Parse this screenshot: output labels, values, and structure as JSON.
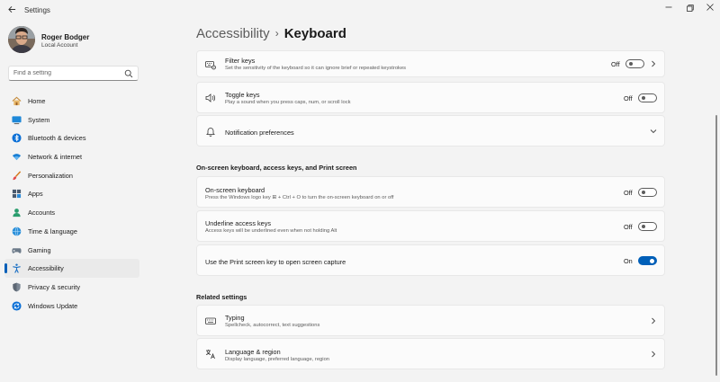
{
  "window": {
    "app_title": "Settings",
    "back_icon": "back-arrow-icon",
    "controls": [
      "minimize-icon",
      "restore-icon",
      "close-icon"
    ]
  },
  "profile": {
    "name": "Roger Bodger",
    "account_type": "Local Account"
  },
  "search": {
    "placeholder": "Find a setting"
  },
  "sidebar": {
    "items": [
      {
        "label": "Home",
        "icon": "home-icon"
      },
      {
        "label": "System",
        "icon": "system-icon"
      },
      {
        "label": "Bluetooth & devices",
        "icon": "bluetooth-icon"
      },
      {
        "label": "Network & internet",
        "icon": "network-icon"
      },
      {
        "label": "Personalization",
        "icon": "brush-icon"
      },
      {
        "label": "Apps",
        "icon": "apps-icon"
      },
      {
        "label": "Accounts",
        "icon": "accounts-icon"
      },
      {
        "label": "Time & language",
        "icon": "globe-clock-icon"
      },
      {
        "label": "Gaming",
        "icon": "gamepad-icon"
      },
      {
        "label": "Accessibility",
        "icon": "accessibility-icon",
        "active": true
      },
      {
        "label": "Privacy & security",
        "icon": "shield-icon"
      },
      {
        "label": "Windows Update",
        "icon": "update-icon"
      }
    ]
  },
  "breadcrumb": {
    "parent": "Accessibility",
    "separator": "›",
    "current": "Keyboard"
  },
  "cards": {
    "filter_keys": {
      "title": "Filter keys",
      "desc": "Set the sensitivity of the keyboard so it can ignore brief or repeated keystrokes",
      "state": "Off"
    },
    "toggle_keys": {
      "title": "Toggle keys",
      "desc": "Play a sound when you press caps, num, or scroll lock",
      "state": "Off"
    },
    "notification_prefs": {
      "title": "Notification preferences"
    },
    "osk": {
      "title": "On-screen keyboard",
      "desc": "Press the Windows logo key ⊞ + Ctrl + O to turn the on-screen keyboard on or off",
      "state": "Off"
    },
    "underline": {
      "title": "Underline access keys",
      "desc": "Access keys will be underlined even when not holding Alt",
      "state": "Off"
    },
    "print_screen": {
      "title": "Use the Print screen key to open screen capture",
      "state": "On"
    },
    "typing": {
      "title": "Typing",
      "desc": "Spellcheck, autocorrect, text suggestions"
    },
    "language": {
      "title": "Language & region",
      "desc": "Display language, preferred language, region"
    }
  },
  "sections": {
    "osk_heading": "On-screen keyboard, access keys, and Print screen",
    "related_heading": "Related settings"
  },
  "colors": {
    "accent": "#005fb8",
    "background": "#f3f3f3",
    "card": "#fbfbfb"
  }
}
